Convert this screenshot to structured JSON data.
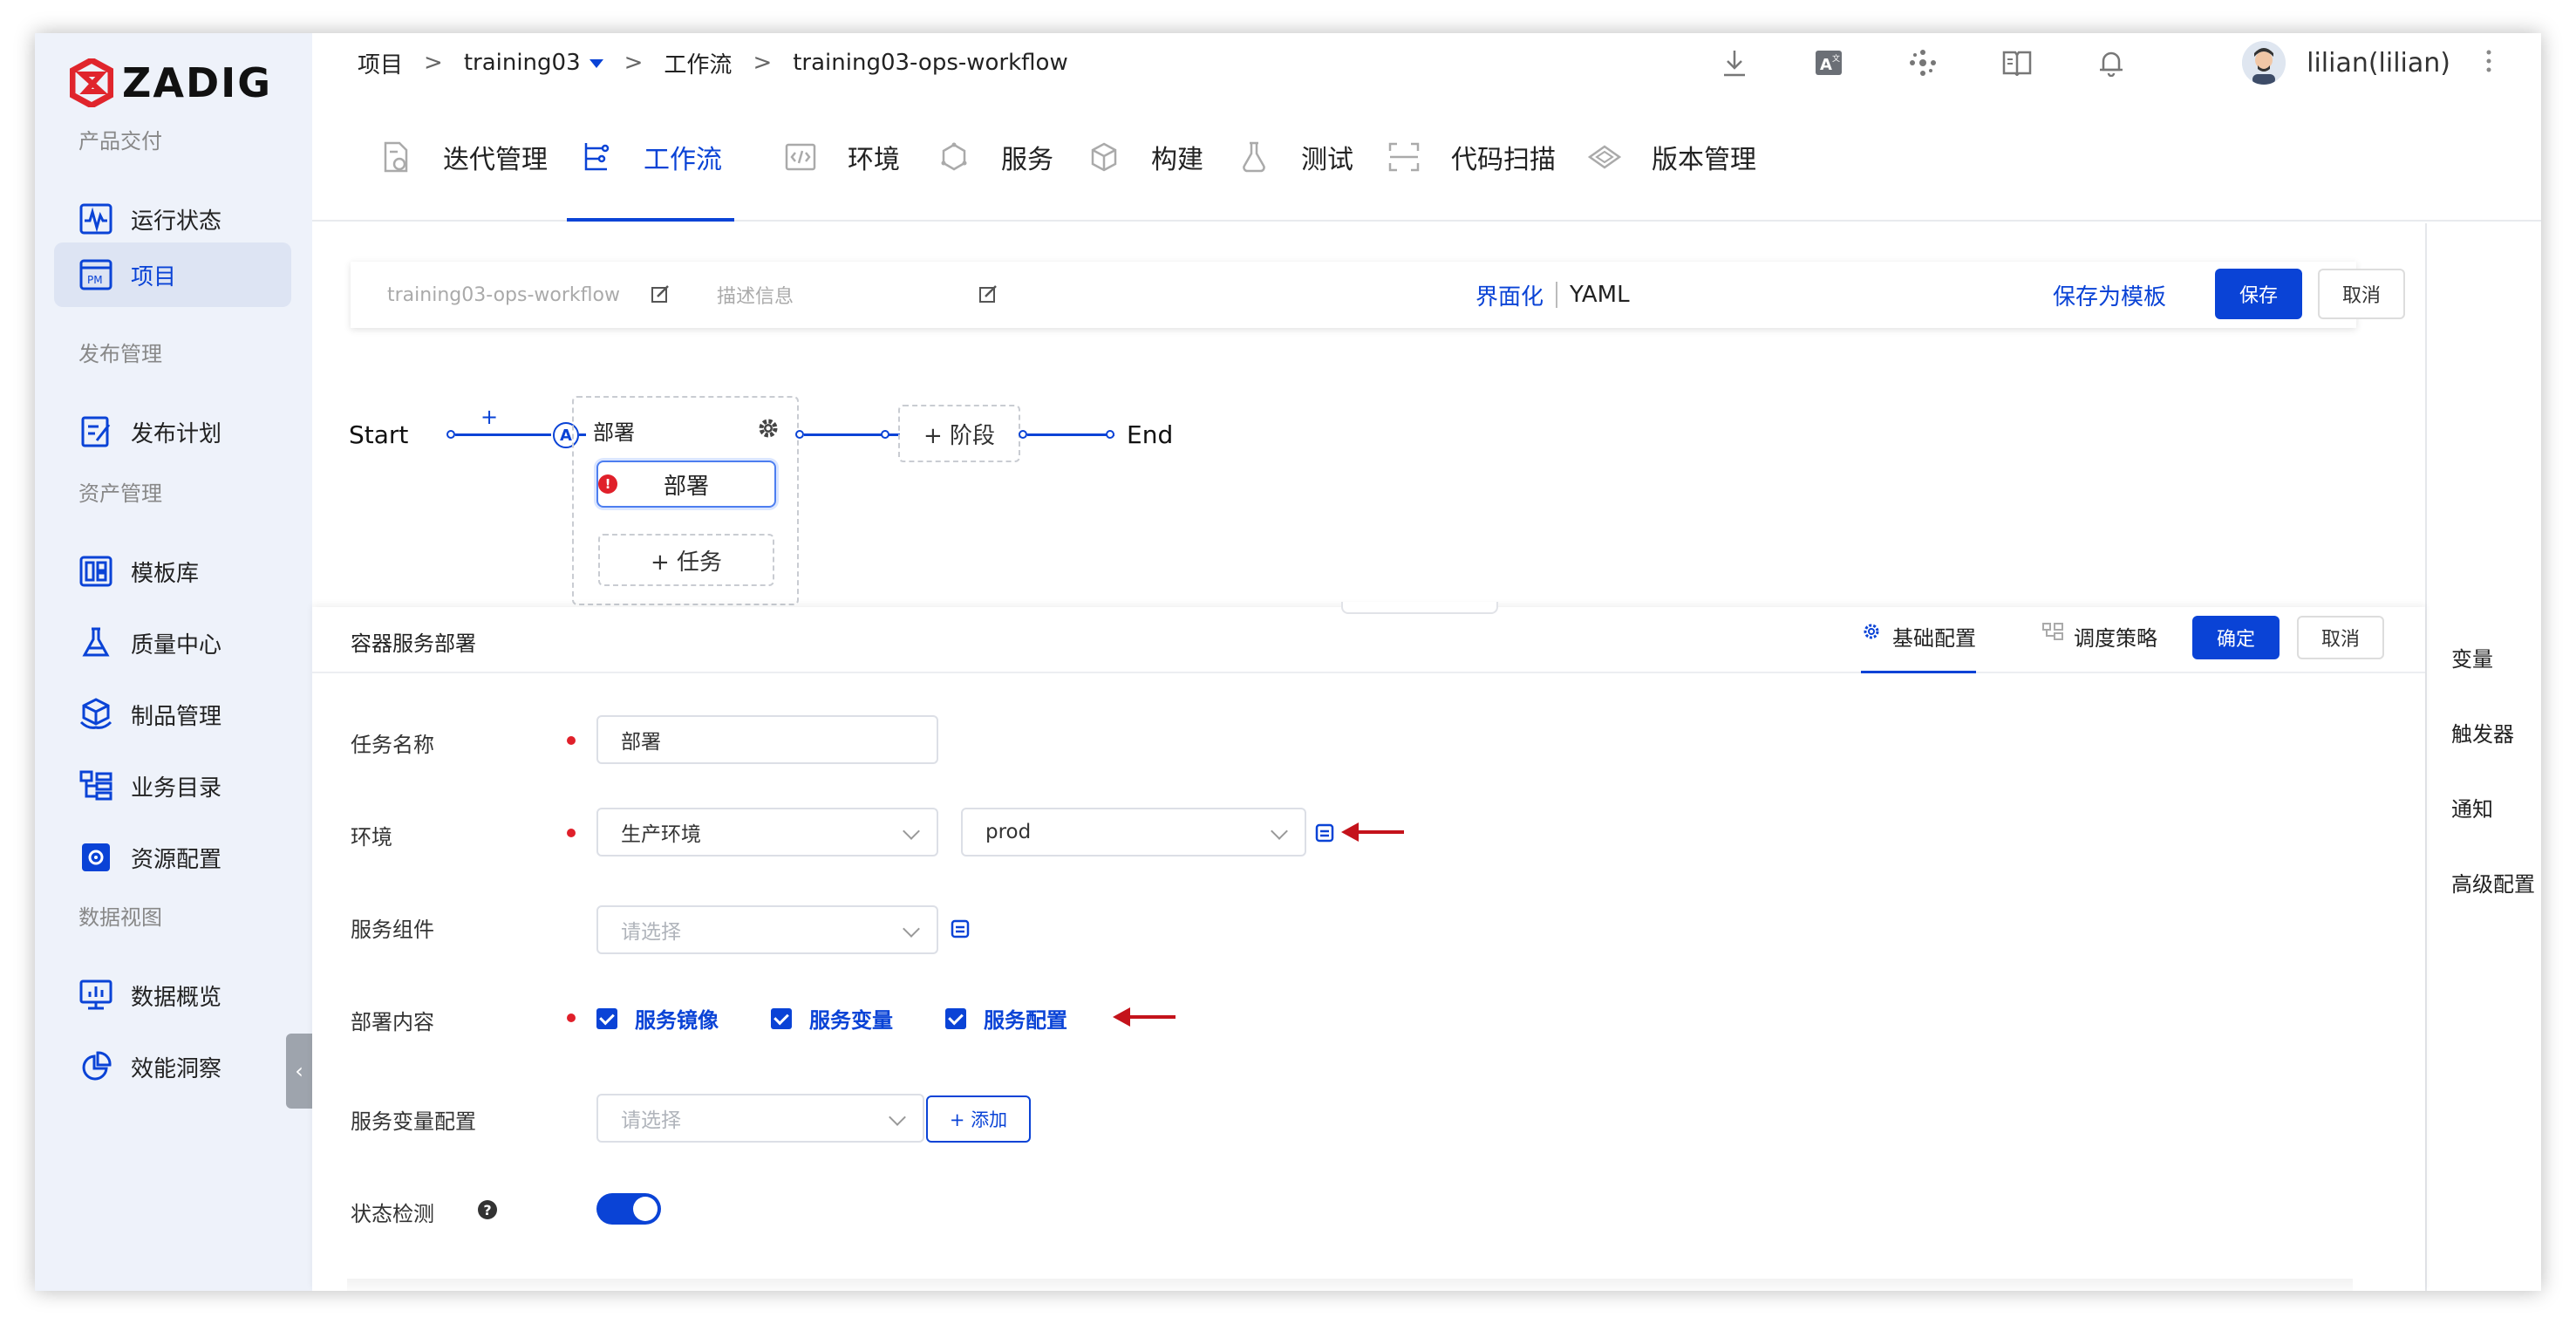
{
  "brand": {
    "logo_text": "ZADIG",
    "accent": "#0a43d6",
    "logo_color": "#e0252c"
  },
  "sidebar": {
    "sections": [
      {
        "title": "产品交付"
      },
      {
        "title": "发布管理"
      },
      {
        "title": "资产管理"
      },
      {
        "title": "数据视图"
      }
    ],
    "items": [
      {
        "label": "运行状态",
        "icon": "pulse-icon"
      },
      {
        "label": "项目",
        "icon": "pm-icon",
        "active": true
      },
      {
        "label": "发布计划",
        "icon": "release-plan-icon"
      },
      {
        "label": "模板库",
        "icon": "template-icon"
      },
      {
        "label": "质量中心",
        "icon": "flask-icon"
      },
      {
        "label": "制品管理",
        "icon": "artifact-icon"
      },
      {
        "label": "业务目录",
        "icon": "catalog-icon"
      },
      {
        "label": "资源配置",
        "icon": "settings-icon"
      },
      {
        "label": "数据概览",
        "icon": "dashboard-icon"
      },
      {
        "label": "效能洞察",
        "icon": "pie-icon"
      }
    ]
  },
  "breadcrumb": {
    "items": [
      "项目",
      "training03",
      "工作流",
      "training03-ops-workflow"
    ],
    "separator": ">"
  },
  "header": {
    "icons": [
      "download-icon",
      "translate-icon",
      "plugin-icon",
      "docs-icon",
      "bell-icon"
    ],
    "user": "lilian(lilian)",
    "more_icon": "more-vertical-icon"
  },
  "tabs": [
    {
      "label": "迭代管理",
      "icon": "iteration-icon"
    },
    {
      "label": "工作流",
      "icon": "workflow-icon",
      "active": true
    },
    {
      "label": "环境",
      "icon": "code-env-icon"
    },
    {
      "label": "服务",
      "icon": "service-icon"
    },
    {
      "label": "构建",
      "icon": "build-icon"
    },
    {
      "label": "测试",
      "icon": "test-icon"
    },
    {
      "label": "代码扫描",
      "icon": "scan-icon"
    },
    {
      "label": "版本管理",
      "icon": "version-icon"
    }
  ],
  "workflow_bar": {
    "name": "training03-ops-workflow",
    "description_placeholder": "描述信息",
    "mode_ui": "界面化",
    "mode_yaml": "YAML",
    "save_template": "保存为模板",
    "save": "保存",
    "cancel": "取消"
  },
  "flow": {
    "start": "Start",
    "plus": "+",
    "approval_badge": "A",
    "stage_name": "部署",
    "job_name": "部署",
    "add_job": "+ 任务",
    "add_stage": "+ 阶段",
    "end": "End"
  },
  "right_panel": {
    "items": [
      "变量",
      "触发器",
      "通知",
      "高级配置"
    ]
  },
  "drawer": {
    "title": "容器服务部署",
    "tab_basic": "基础配置",
    "tab_schedule": "调度策略",
    "confirm": "确定",
    "cancel": "取消",
    "fields": {
      "task_name": {
        "label": "任务名称",
        "value": "部署"
      },
      "env": {
        "label": "环境",
        "type_value": "生产环境",
        "env_value": "prod"
      },
      "service": {
        "label": "服务组件",
        "placeholder": "请选择"
      },
      "deploy_content": {
        "label": "部署内容",
        "options": [
          "服务镜像",
          "服务变量",
          "服务配置"
        ]
      },
      "var_config": {
        "label": "服务变量配置",
        "placeholder": "请选择",
        "add": "+ 添加"
      },
      "health_check": {
        "label": "状态检测",
        "help": "?",
        "enabled": true
      }
    }
  }
}
